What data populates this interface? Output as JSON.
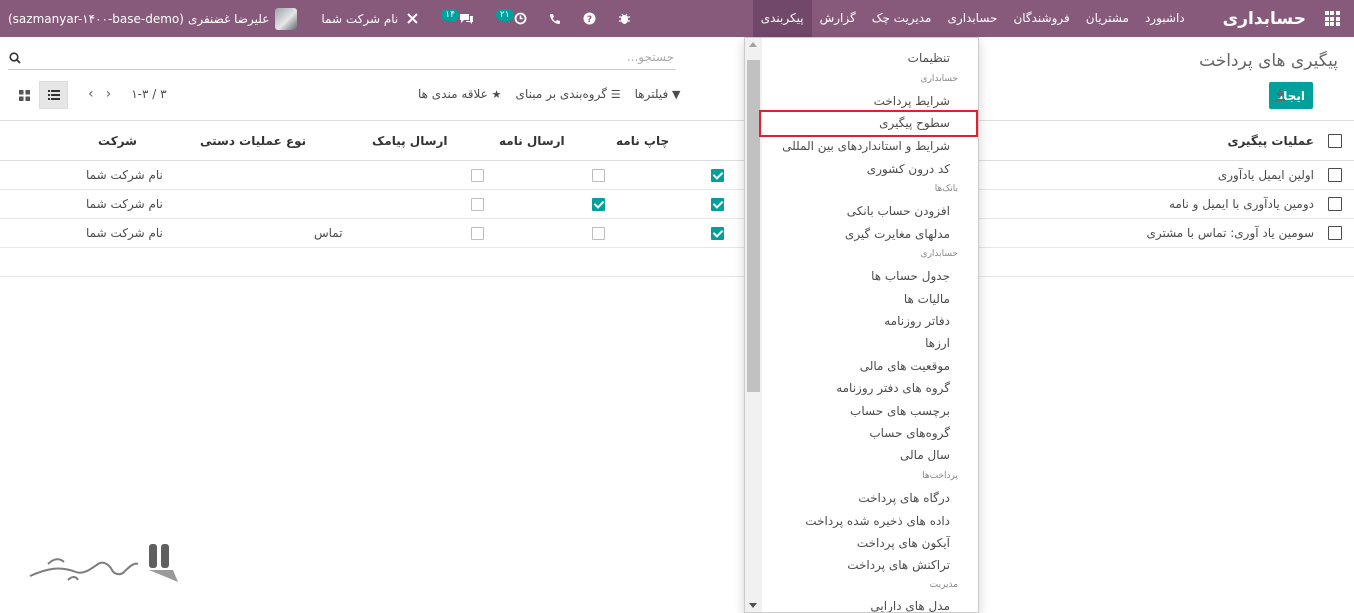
{
  "navbar": {
    "brand": "حسابداری",
    "menu": [
      "داشبورد",
      "مشتریان",
      "فروشندگان",
      "حسابداری",
      "مدیریت چک",
      "گزارش",
      "پیکربندی"
    ],
    "active_menu": "پیکربندی",
    "db_name": "(sazmanyar-۱۴۰۰-base-demo)",
    "user_name": "علیرضا غضنفری",
    "company": "نام شرکت شما",
    "messages_count": "۱۴",
    "activities_count": "۲۱"
  },
  "control_panel": {
    "breadcrumb": "پیگیری های پرداخت",
    "create_label": "ایجاد",
    "search_placeholder": "جستجو...",
    "filters_label": "فیلترها",
    "groupby_label": "گروه‌بندی بر مبنای",
    "favorites_label": "علاقه مندی ها",
    "pager_value": "۱-۳ / ۳"
  },
  "table": {
    "headers": {
      "name": "عملیات پیگیری",
      "print_letter": "چاپ نامه",
      "send_letter": "ارسال نامه",
      "send_sms": "ارسال پیامک",
      "manual_action_type": "نوع عملیات دستی",
      "company": "شرکت"
    },
    "rows": [
      {
        "name": "اولین ایمیل یادآوری",
        "print_letter": true,
        "send_letter": false,
        "send_sms": false,
        "manual_action_type": "",
        "company": "نام شرکت شما"
      },
      {
        "name": "دومین یادآوری با ایمیل و نامه",
        "print_letter": true,
        "send_letter": true,
        "send_sms": false,
        "manual_action_type": "",
        "company": "نام شرکت شما"
      },
      {
        "name": "سومین یاد آوری: تماس با مشتری",
        "print_letter": true,
        "send_letter": false,
        "send_sms": false,
        "manual_action_type": "تماس",
        "company": "نام شرکت شما"
      }
    ]
  },
  "dropdown": {
    "items": [
      {
        "type": "item",
        "label": "تنظیمات"
      },
      {
        "type": "header",
        "label": "حسابداری"
      },
      {
        "type": "item",
        "label": "شرایط پرداخت"
      },
      {
        "type": "item",
        "label": "سطوح پیگیری",
        "highlighted": true
      },
      {
        "type": "item",
        "label": "شرایط و استانداردهای بین المللی"
      },
      {
        "type": "item",
        "label": "کد درون کشوری"
      },
      {
        "type": "header",
        "label": "بانک‌ها"
      },
      {
        "type": "item",
        "label": "افزودن حساب بانکی"
      },
      {
        "type": "item",
        "label": "مدلهای مغایرت گیری"
      },
      {
        "type": "header",
        "label": "حسابداری"
      },
      {
        "type": "item",
        "label": "جدول حساب ها"
      },
      {
        "type": "item",
        "label": "مالیات ها"
      },
      {
        "type": "item",
        "label": "دفاتر روزنامه"
      },
      {
        "type": "item",
        "label": "ارزها"
      },
      {
        "type": "item",
        "label": "موقعیت های مالی"
      },
      {
        "type": "item",
        "label": "گروه های دفتر روزنامه"
      },
      {
        "type": "item",
        "label": "برچسب های حساب"
      },
      {
        "type": "item",
        "label": "گروه‌های حساب"
      },
      {
        "type": "item",
        "label": "سال مالی"
      },
      {
        "type": "header",
        "label": "پرداخت‌ها"
      },
      {
        "type": "item",
        "label": "درگاه های پرداخت"
      },
      {
        "type": "item",
        "label": "داده های ذخیره شده پرداخت"
      },
      {
        "type": "item",
        "label": "آیکون های پرداخت"
      },
      {
        "type": "item",
        "label": "تراکنش های پرداخت"
      },
      {
        "type": "header",
        "label": "مدیریت"
      },
      {
        "type": "item",
        "label": "مدل های دارایی"
      }
    ]
  },
  "colors": {
    "navbar": "#875a7b",
    "primary_button": "#00a09d",
    "highlight_border": "#e0202c"
  }
}
